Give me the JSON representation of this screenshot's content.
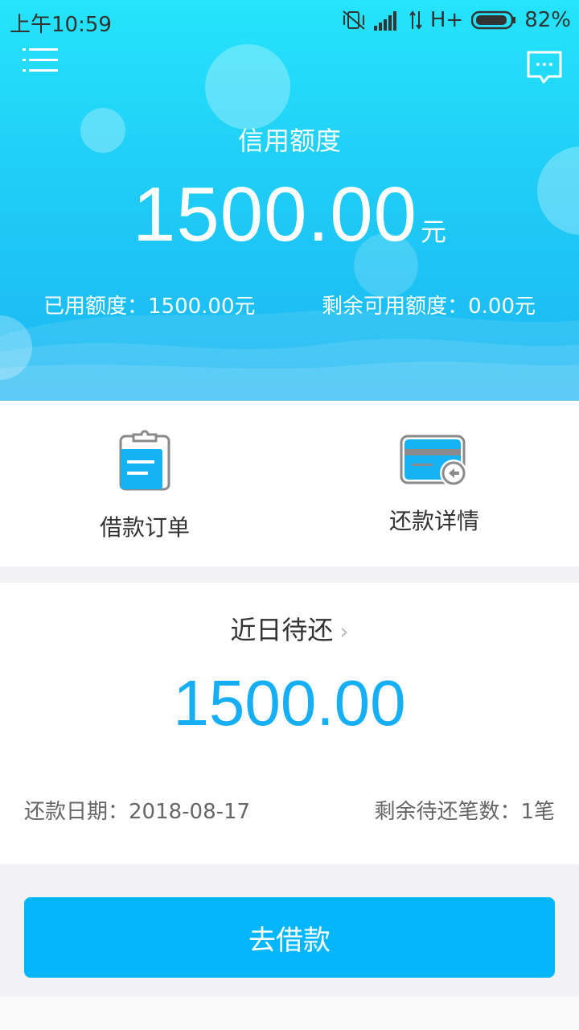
{
  "status_bar": {
    "time": "上午10:59",
    "network": "H+",
    "battery": "82%"
  },
  "header": {
    "menu_icon": "menu-icon",
    "message_icon": "message-icon"
  },
  "credit": {
    "title": "信用额度",
    "amount": "1500.00",
    "unit": "元",
    "used": "已用额度：1500.00元",
    "remaining": "剩余可用额度：0.00元"
  },
  "actions": [
    {
      "label": "借款订单",
      "icon": "clipboard-icon"
    },
    {
      "label": "还款详情",
      "icon": "card-return-icon"
    }
  ],
  "repay": {
    "title": "近日待还",
    "chevron": "›",
    "amount": "1500.00",
    "date": "还款日期：2018-08-17",
    "count": "剩余待还笔数：1笔"
  },
  "primary_button": {
    "label": "去借款"
  },
  "colors": {
    "accent": "#04b6fc",
    "amount_blue": "#16aef4",
    "hero_top": "#25e4fb",
    "hero_bottom": "#1bb6f2"
  }
}
